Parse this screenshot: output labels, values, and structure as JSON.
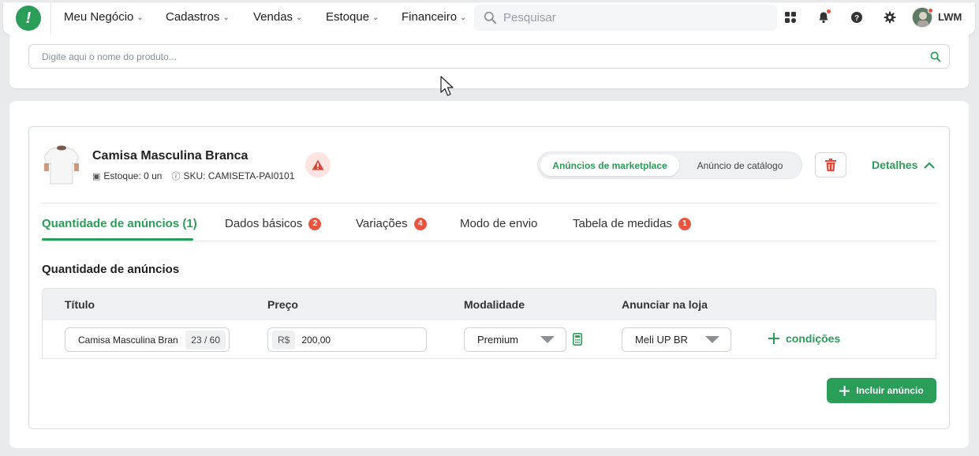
{
  "nav": {
    "menu": [
      {
        "label": "Meu Negócio"
      },
      {
        "label": "Cadastros"
      },
      {
        "label": "Vendas"
      },
      {
        "label": "Estoque"
      },
      {
        "label": "Financeiro"
      }
    ],
    "search_placeholder": "Pesquisar",
    "user_initials": "LWM"
  },
  "product_search": {
    "placeholder": "Digite aqui o nome do produto..."
  },
  "product": {
    "name": "Camisa Masculina Branca",
    "stock": "Estoque: 0 un",
    "sku": "SKU: CAMISETA-PAI0101"
  },
  "segmented": {
    "active": "Anúncios de marketplace",
    "other": "Anúncio de catálogo"
  },
  "details_label": "Detalhes",
  "tabs": [
    {
      "label": "Quantidade de anúncios (1)",
      "badge": ""
    },
    {
      "label": "Dados básicos",
      "badge": "2"
    },
    {
      "label": "Variações",
      "badge": "4"
    },
    {
      "label": "Modo de envio",
      "badge": ""
    },
    {
      "label": "Tabela de medidas",
      "badge": "1"
    }
  ],
  "section_title": "Quantidade de anúncios",
  "table": {
    "headers": [
      "Título",
      "Preço",
      "Modalidade",
      "Anunciar na loja"
    ],
    "row": {
      "title_value": "Camisa Masculina Bran",
      "title_counter": "23 / 60",
      "currency": "R$",
      "price_value": "200,00",
      "modality": "Premium",
      "store": "Meli UP BR",
      "conditions_label": "condições"
    }
  },
  "include_button": "Incluir anúncio",
  "colors": {
    "brand_green": "#2a9d58",
    "badge_red": "#e9553f"
  }
}
